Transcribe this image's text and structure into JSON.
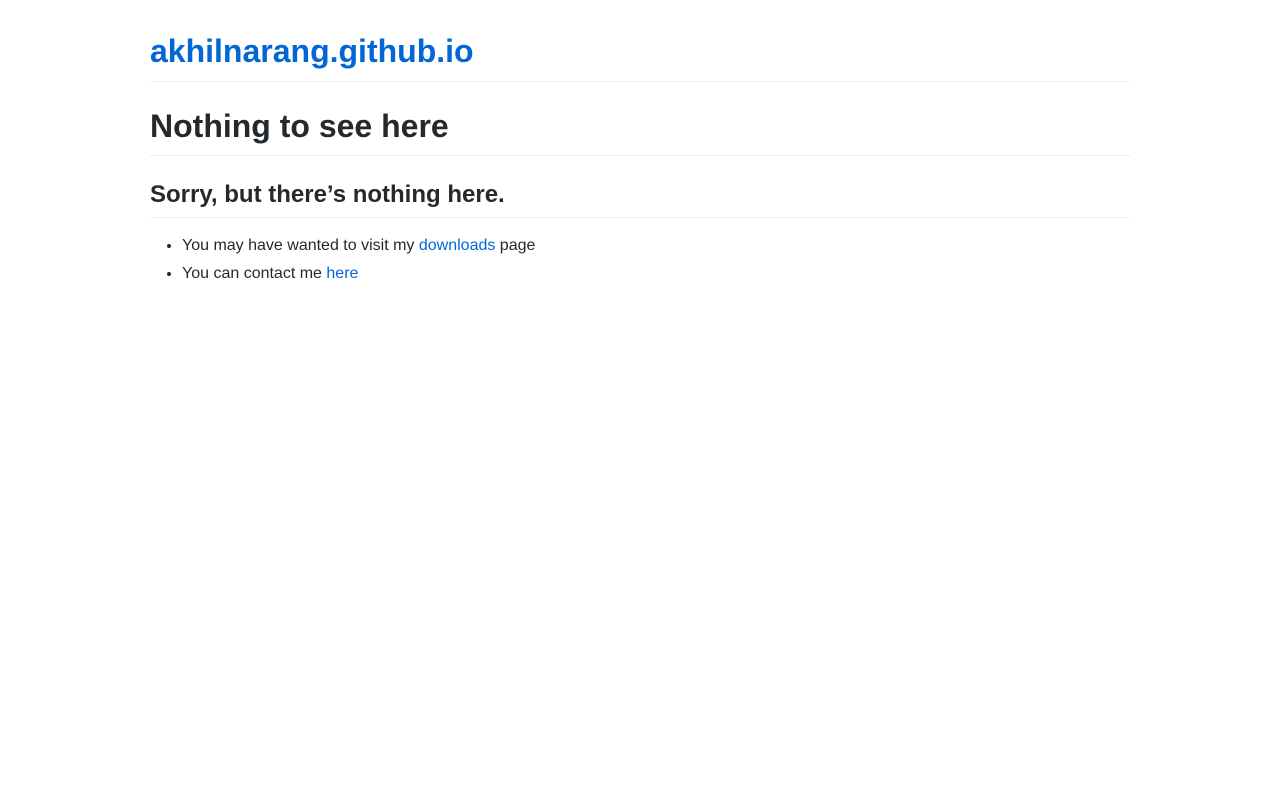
{
  "header": {
    "site_title": "akhilnarang.github.io"
  },
  "main": {
    "heading": "Nothing to see here",
    "subheading": "Sorry, but there’s nothing here.",
    "items": [
      {
        "prefix": "You may have wanted to visit my ",
        "link_text": "downloads",
        "suffix": " page"
      },
      {
        "prefix": "You can contact me ",
        "link_text": "here",
        "suffix": ""
      }
    ]
  },
  "colors": {
    "link": "#0366d6",
    "text": "#24292e",
    "divider": "#eaecef",
    "background": "#ffffff"
  }
}
